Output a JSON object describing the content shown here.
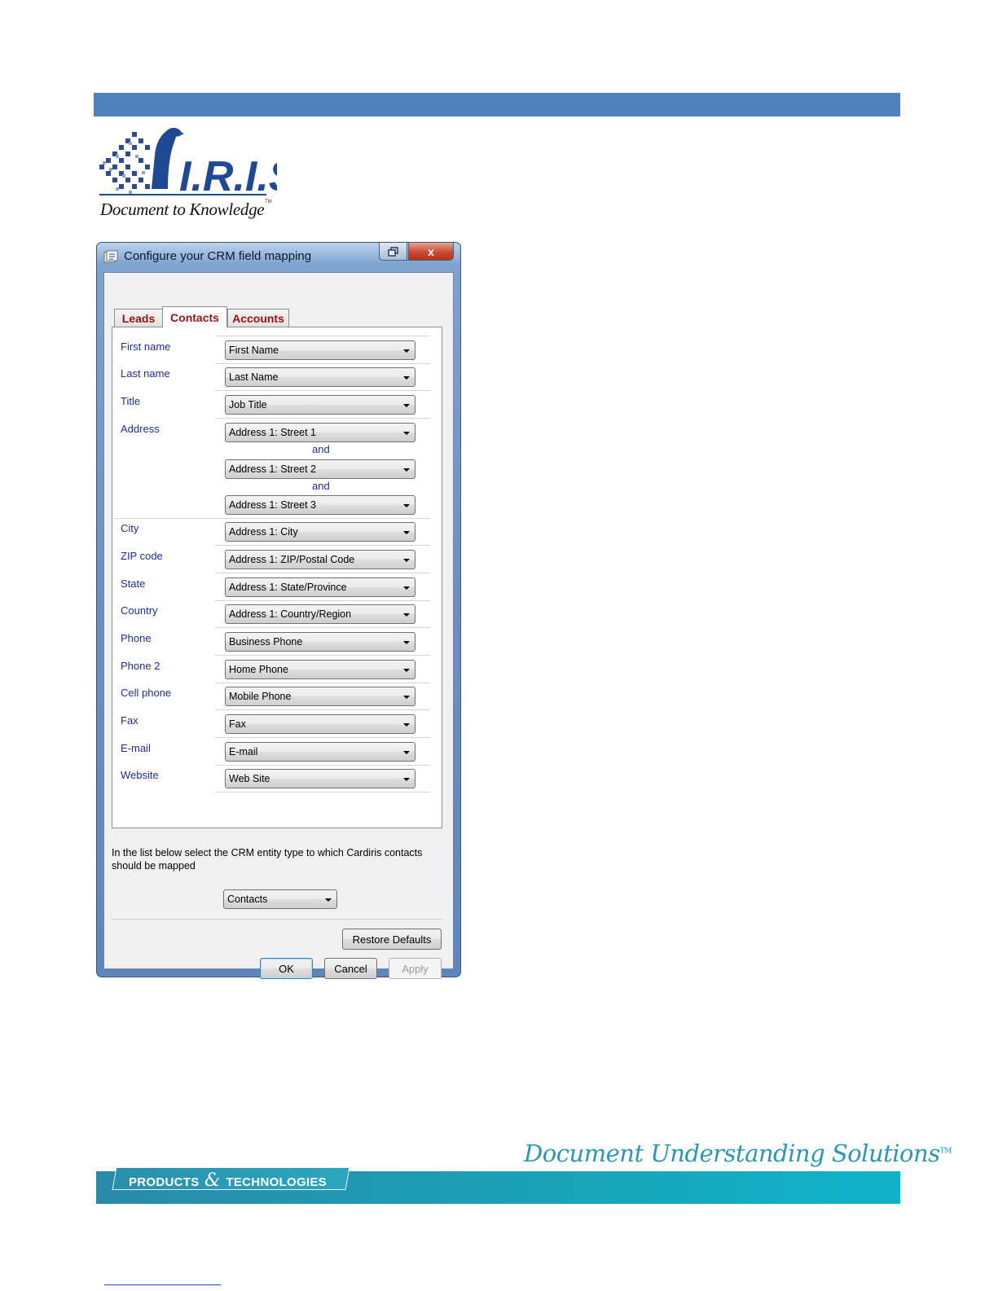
{
  "header": {
    "bar_color": "#4f81bd"
  },
  "logo": {
    "brand": "I.R.I.S.",
    "tagline": "Document to Knowledge",
    "tm": "TM"
  },
  "dialog": {
    "title": "Configure your CRM field mapping",
    "close_label": "x",
    "tabs": [
      {
        "label": "Leads",
        "active": false
      },
      {
        "label": "Contacts",
        "active": true
      },
      {
        "label": "Accounts",
        "active": false
      }
    ],
    "fields": {
      "first_name": {
        "label": "First name",
        "value": "First Name"
      },
      "last_name": {
        "label": "Last name",
        "value": "Last Name"
      },
      "title": {
        "label": "Title",
        "value": "Job Title"
      },
      "address": {
        "label": "Address",
        "value1": "Address 1: Street 1",
        "value2": "Address 1: Street 2",
        "value3": "Address 1: Street 3",
        "joiner": "and"
      },
      "city": {
        "label": "City",
        "value": "Address 1: City"
      },
      "zip": {
        "label": "ZIP code",
        "value": "Address 1: ZIP/Postal Code"
      },
      "state": {
        "label": "State",
        "value": "Address 1: State/Province"
      },
      "country": {
        "label": "Country",
        "value": "Address 1: Country/Region"
      },
      "phone": {
        "label": "Phone",
        "value": "Business Phone"
      },
      "phone2": {
        "label": "Phone 2",
        "value": "Home Phone"
      },
      "cell": {
        "label": "Cell phone",
        "value": "Mobile Phone"
      },
      "fax": {
        "label": "Fax",
        "value": "Fax"
      },
      "email": {
        "label": "E-mail",
        "value": "E-mail"
      },
      "website": {
        "label": "Website",
        "value": "Web Site"
      }
    },
    "instruction": "In the list below select the CRM entity type to which Cardiris contacts should be mapped",
    "entity_type": "Contacts",
    "buttons": {
      "restore": "Restore Defaults",
      "ok": "OK",
      "cancel": "Cancel",
      "apply": "Apply"
    }
  },
  "footer": {
    "products_left": "PRODUCTS",
    "products_amp": "&",
    "products_right": "TECHNOLOGIES",
    "tagline": "Document Understanding Solutions",
    "tm": "TM"
  }
}
